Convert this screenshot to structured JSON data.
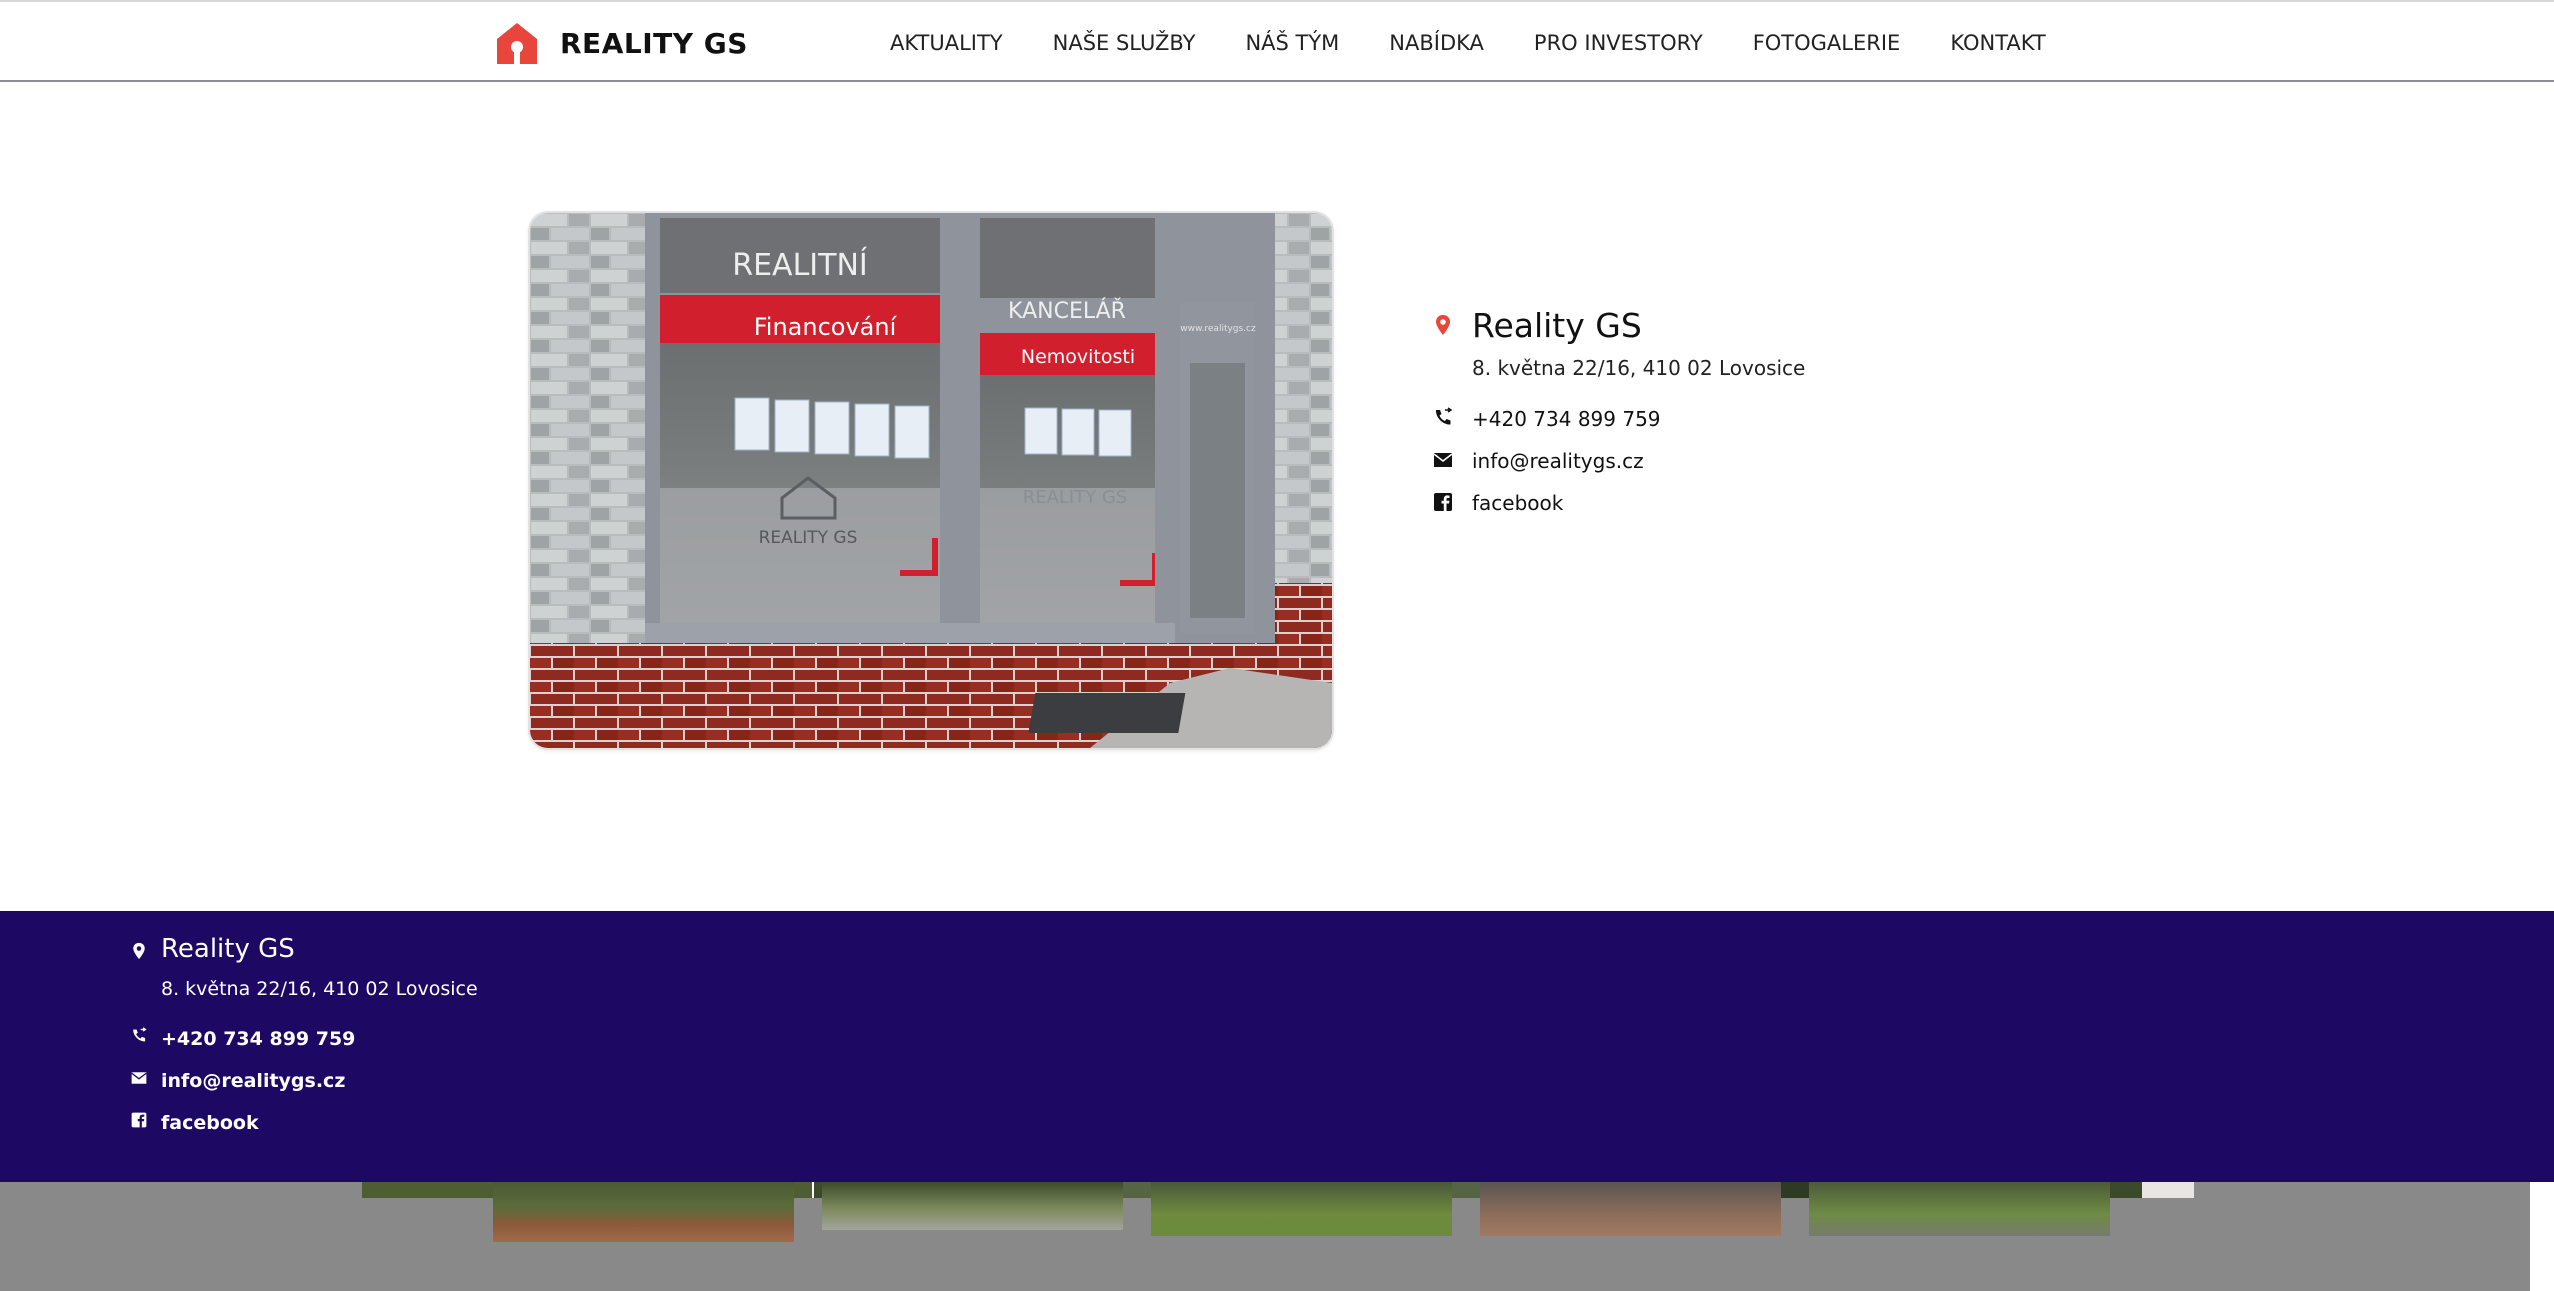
{
  "brand": {
    "name": "REALITY GS",
    "accent": "#e8453c"
  },
  "nav": {
    "items": [
      "AKTUALITY",
      "NAŠE SLUŽBY",
      "NÁŠ TÝM",
      "NABÍDKA",
      "PRO INVESTORY",
      "FOTOGALERIE",
      "KONTAKT"
    ]
  },
  "photo": {
    "signs": {
      "realitni": "REALITNÍ",
      "kancelar": "KANCELÁŘ",
      "financovani": "Financování",
      "nemovitosti": "Nemovitosti",
      "logo_left": "REALITY GS",
      "logo_right": "REALITY GS",
      "door_url": "www.realitygs.cz"
    }
  },
  "contact": {
    "name": "Reality GS",
    "address": "8. května 22/16, 410 02 Lovosice",
    "phone": "+420 734 899 759",
    "email": "info@realitygs.cz",
    "facebook": "facebook"
  },
  "footer": {
    "background": "#1d0863",
    "contact": {
      "name": "Reality GS",
      "address": "8. května 22/16, 410 02 Lovosice",
      "phone": "+420 734 899 759",
      "email": "info@realitygs.cz",
      "facebook": "facebook"
    }
  },
  "icons": [
    "home-icon",
    "location-pin-icon",
    "phone-icon",
    "mail-icon",
    "facebook-icon"
  ]
}
